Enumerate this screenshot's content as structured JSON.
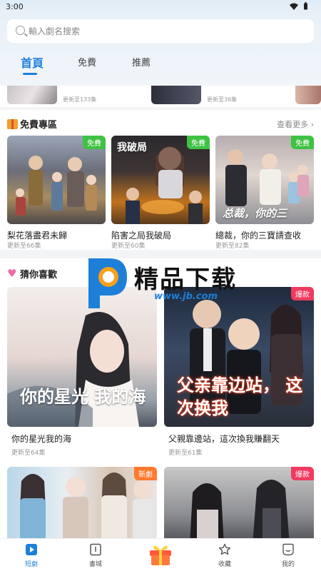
{
  "status_bar": {
    "time": "3:00"
  },
  "search": {
    "placeholder": "輸入劇名搜索"
  },
  "tabs": [
    {
      "label": "首頁",
      "active": true
    },
    {
      "label": "免費",
      "active": false
    },
    {
      "label": "推薦",
      "active": false
    }
  ],
  "previous_row": [
    {
      "meta": "更新至133集"
    },
    {
      "meta": "更新至36集"
    }
  ],
  "free_section": {
    "title": "免費專區",
    "see_more": "查看更多",
    "items": [
      {
        "title": "梨花落盡君未歸",
        "meta": "更新至66集",
        "badge": "免費",
        "poster_text": ""
      },
      {
        "title": "陷害之局我破局",
        "meta": "更新至60集",
        "badge": "免費",
        "poster_text": "我破局"
      },
      {
        "title": "總裁，你的三寶請查收",
        "meta": "更新至82集",
        "badge": "免費",
        "poster_text": "总裁，你的三"
      }
    ]
  },
  "guess_section": {
    "title": "猜你喜歡",
    "items": [
      {
        "title": "你的星光我的海",
        "meta": "更新至64集",
        "badge": "",
        "poster_text": "你的星光 我的海"
      },
      {
        "title": "父親靠邊站，這次換我賺翻天",
        "meta": "更新至61集",
        "badge": "爆款",
        "poster_text": "父亲靠边站， 这次换我"
      },
      {
        "title": "",
        "meta": "",
        "badge": "新劇",
        "poster_text": ""
      },
      {
        "title": "",
        "meta": "",
        "badge": "爆款",
        "poster_text": ""
      }
    ]
  },
  "watermark": {
    "text": "精品下载",
    "url": "www.jb.com"
  },
  "bottom_nav": [
    {
      "label": "短劇",
      "icon": "play-icon",
      "active": true
    },
    {
      "label": "書城",
      "icon": "book-icon",
      "active": false
    },
    {
      "label": "",
      "icon": "gift-icon",
      "active": false
    },
    {
      "label": "收藏",
      "icon": "star-icon",
      "active": false
    },
    {
      "label": "我的",
      "icon": "profile-icon",
      "active": false
    }
  ],
  "colors": {
    "accent": "#1e7fd8",
    "free_badge": "#3fc243",
    "new_badge": "#ff7a2f",
    "hot_badge": "#f03a5f"
  }
}
